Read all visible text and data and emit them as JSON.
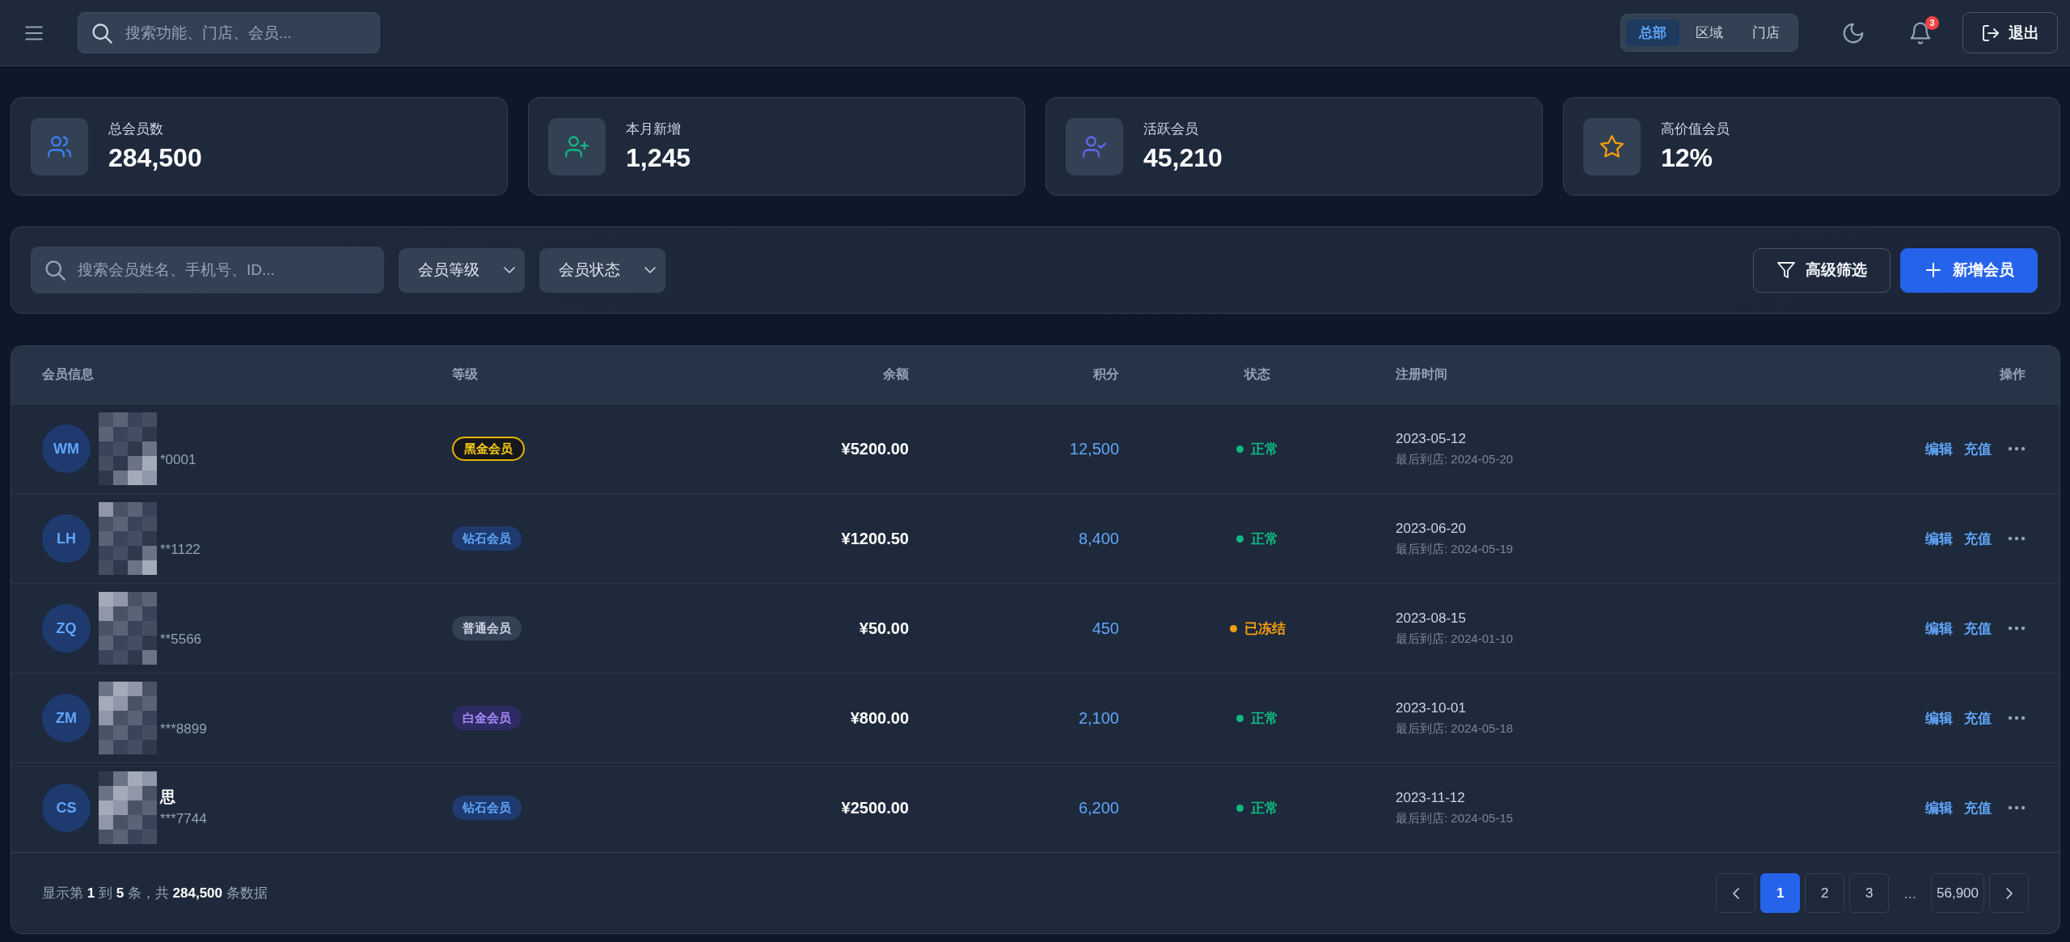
{
  "header": {
    "search": {
      "placeholder": "搜索功能、门店、会员..."
    },
    "scopes": [
      {
        "label": "总部",
        "selected": true
      },
      {
        "label": "区域",
        "selected": false
      },
      {
        "label": "门店",
        "selected": false
      }
    ],
    "notifications": {
      "count": "3"
    },
    "logout": {
      "label": "退出"
    }
  },
  "stats": [
    {
      "label": "总会员数",
      "value": "284,500",
      "color": "#3b82f6"
    },
    {
      "label": "本月新增",
      "value": "1,245",
      "color": "#10b981"
    },
    {
      "label": "活跃会员",
      "value": "45,210",
      "color": "#6366f1"
    },
    {
      "label": "高价值会员",
      "value": "12%",
      "color": "#f59e0b"
    }
  ],
  "filters": {
    "search": {
      "placeholder": "搜索会员姓名、手机号、ID..."
    },
    "dropdowns": [
      {
        "value": "会员等级"
      },
      {
        "value": "会员状态"
      }
    ],
    "buttons": [
      {
        "label": "高级筛选",
        "kind": "outline"
      },
      {
        "label": "新增会员",
        "kind": "primary"
      }
    ]
  },
  "table": {
    "columns": [
      {
        "label": "会员信息"
      },
      {
        "label": "等级"
      },
      {
        "label": "余额"
      },
      {
        "label": "积分"
      },
      {
        "label": "状态"
      },
      {
        "label": "注册时间"
      },
      {
        "label": "操作"
      }
    ],
    "rows": [
      {
        "initials": "WM",
        "redacted": true,
        "phone": "*0001",
        "tier": {
          "label": "黑金会员",
          "kind": "black-gold"
        },
        "balance": "¥5200.00",
        "points": "12,500",
        "status": {
          "label": "正常",
          "color": "#10b981"
        },
        "registered": "2023-05-12",
        "last_visit": "最后到店: 2024-05-20",
        "actions": [
          "编辑",
          "充值"
        ]
      },
      {
        "initials": "LH",
        "redacted": true,
        "phone": "**1122",
        "tier": {
          "label": "钻石会员",
          "kind": "diamond"
        },
        "balance": "¥1200.50",
        "points": "8,400",
        "status": {
          "label": "正常",
          "color": "#10b981"
        },
        "registered": "2023-06-20",
        "last_visit": "最后到店: 2024-05-19",
        "actions": [
          "编辑",
          "充值"
        ]
      },
      {
        "initials": "ZQ",
        "redacted": true,
        "phone": "**5566",
        "tier": {
          "label": "普通会员",
          "kind": "regular"
        },
        "balance": "¥50.00",
        "points": "450",
        "status": {
          "label": "已冻结",
          "color": "#f59e0b"
        },
        "registered": "2023-08-15",
        "last_visit": "最后到店: 2024-01-10",
        "actions": [
          "编辑",
          "充值"
        ]
      },
      {
        "initials": "ZM",
        "redacted": true,
        "phone": "***8899",
        "tier": {
          "label": "白金会员",
          "kind": "platinum"
        },
        "balance": "¥800.00",
        "points": "2,100",
        "status": {
          "label": "正常",
          "color": "#10b981"
        },
        "registered": "2023-10-01",
        "last_visit": "最后到店: 2024-05-18",
        "actions": [
          "编辑",
          "充值"
        ]
      },
      {
        "initials": "CS",
        "redacted": true,
        "name": "思",
        "phone": "***7744",
        "tier": {
          "label": "钻石会员",
          "kind": "diamond"
        },
        "balance": "¥2500.00",
        "points": "6,200",
        "status": {
          "label": "正常",
          "color": "#10b981"
        },
        "registered": "2023-11-12",
        "last_visit": "最后到店: 2024-05-15",
        "actions": [
          "编辑",
          "充值"
        ]
      }
    ]
  },
  "footer": {
    "summary": "显示第 **1** 到 **5** 条，共 **284,500** 条数据",
    "pages": [
      {
        "label": "1",
        "kind": "page",
        "selected": true
      },
      {
        "label": "2",
        "kind": "page",
        "selected": false
      },
      {
        "label": "3",
        "kind": "page",
        "selected": false
      },
      {
        "label": "...",
        "kind": "ellipsis"
      },
      {
        "label": "56,900",
        "kind": "page",
        "selected": false
      }
    ]
  }
}
